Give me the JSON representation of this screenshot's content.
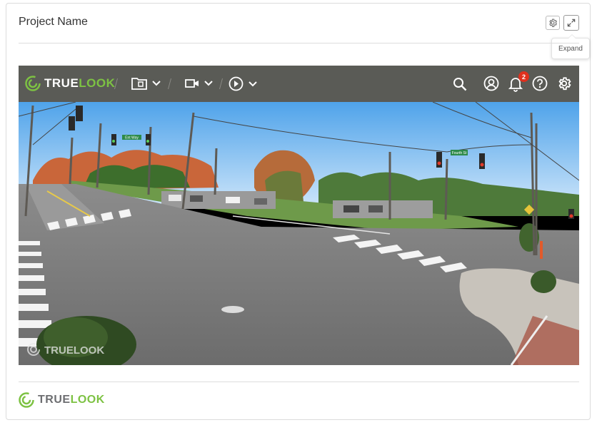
{
  "card": {
    "title": "Project Name",
    "expand_tooltip": "Expand"
  },
  "viewer": {
    "brand": {
      "true": "TRUE",
      "look": "LOOK"
    },
    "notifications_count": "2",
    "watermark": "TRUELOOK",
    "street_signs": [
      "Ent Way",
      "Fourth St"
    ]
  },
  "footer": {
    "brand": {
      "true": "TRUE",
      "look": "LOOK"
    }
  },
  "colors": {
    "brand_green": "#7dc243",
    "toolbar_bg": "#5a5b56",
    "badge_red": "#e0301e"
  }
}
